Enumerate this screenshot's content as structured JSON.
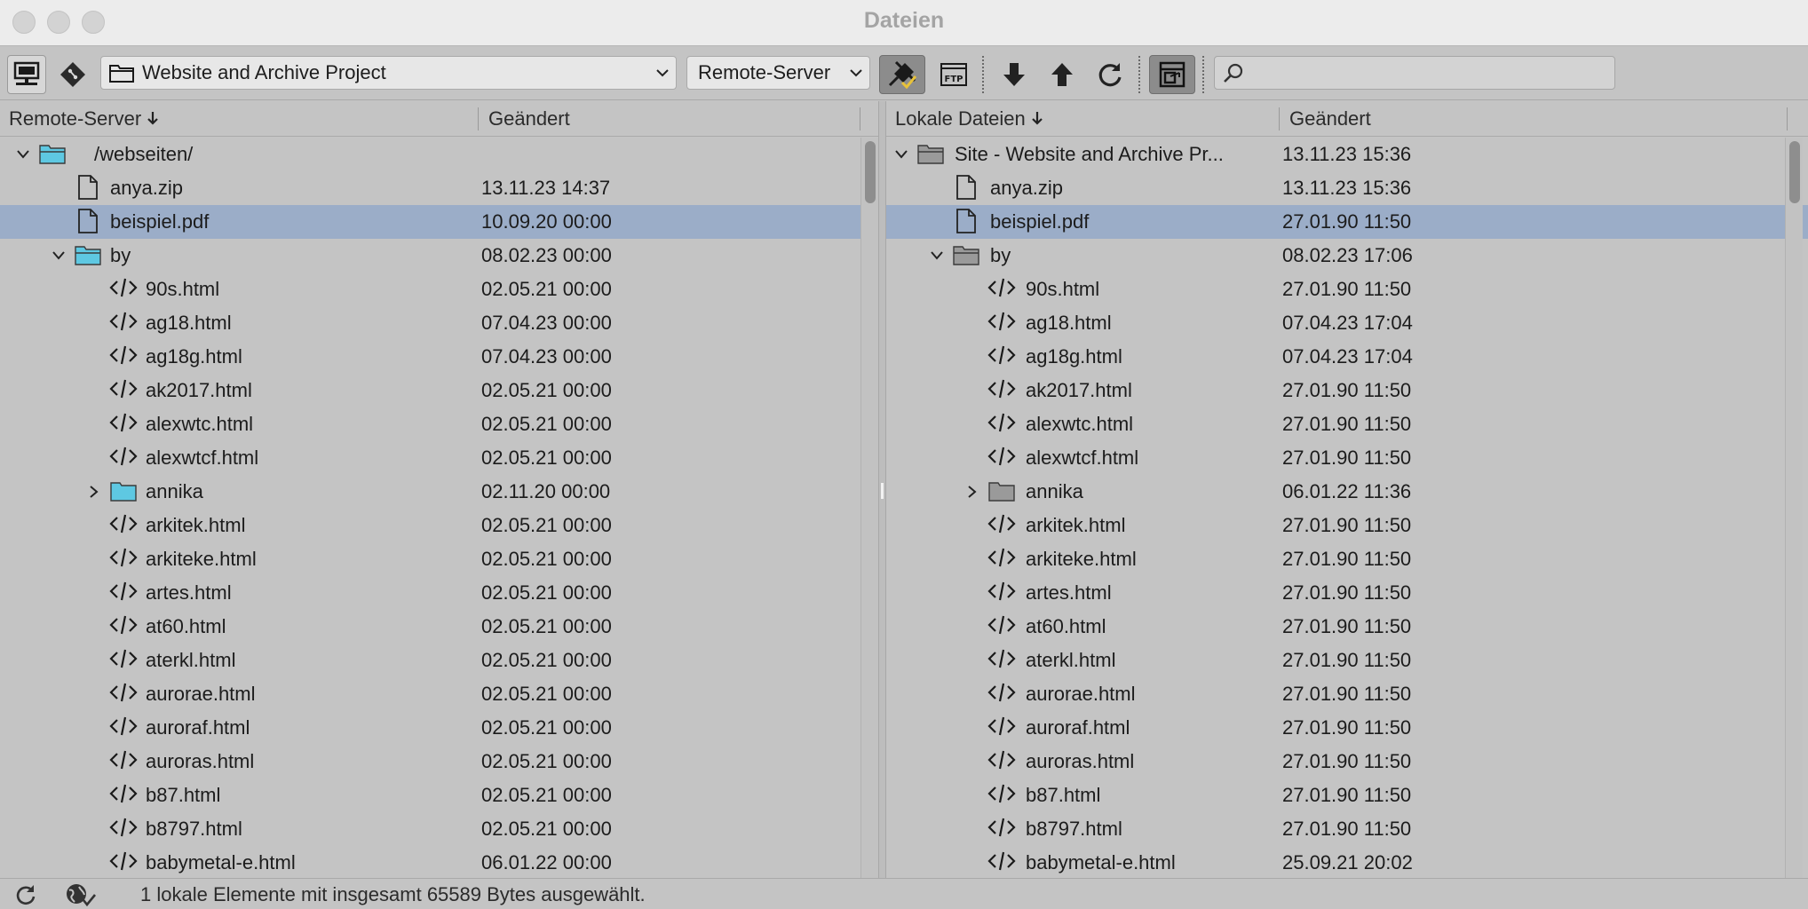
{
  "window": {
    "title": "Dateien"
  },
  "toolbar": {
    "site_select": "Website and Archive Project",
    "view_select": "Remote-Server",
    "search_placeholder": ""
  },
  "left_pane": {
    "col_name": "Remote-Server",
    "col_modified": "Geändert",
    "rows": [
      {
        "name": "/webseiten/",
        "date": "",
        "type": "folder-open",
        "selected": false
      },
      {
        "name": "anya.zip",
        "date": "13.11.23 14:37",
        "type": "file",
        "selected": false
      },
      {
        "name": "beispiel.pdf",
        "date": "10.09.20 00:00",
        "type": "file",
        "selected": true
      },
      {
        "name": "by",
        "date": "08.02.23 00:00",
        "type": "folder-open",
        "selected": false
      },
      {
        "name": "90s.html",
        "date": "02.05.21 00:00",
        "type": "code",
        "selected": false
      },
      {
        "name": "ag18.html",
        "date": "07.04.23 00:00",
        "type": "code",
        "selected": false
      },
      {
        "name": "ag18g.html",
        "date": "07.04.23 00:00",
        "type": "code",
        "selected": false
      },
      {
        "name": "ak2017.html",
        "date": "02.05.21 00:00",
        "type": "code",
        "selected": false
      },
      {
        "name": "alexwtc.html",
        "date": "02.05.21 00:00",
        "type": "code",
        "selected": false
      },
      {
        "name": "alexwtcf.html",
        "date": "02.05.21 00:00",
        "type": "code",
        "selected": false
      },
      {
        "name": "annika",
        "date": "02.11.20 00:00",
        "type": "folder-closed",
        "selected": false
      },
      {
        "name": "arkitek.html",
        "date": "02.05.21 00:00",
        "type": "code",
        "selected": false
      },
      {
        "name": "arkiteke.html",
        "date": "02.05.21 00:00",
        "type": "code",
        "selected": false
      },
      {
        "name": "artes.html",
        "date": "02.05.21 00:00",
        "type": "code",
        "selected": false
      },
      {
        "name": "at60.html",
        "date": "02.05.21 00:00",
        "type": "code",
        "selected": false
      },
      {
        "name": "aterkl.html",
        "date": "02.05.21 00:00",
        "type": "code",
        "selected": false
      },
      {
        "name": "aurorae.html",
        "date": "02.05.21 00:00",
        "type": "code",
        "selected": false
      },
      {
        "name": "auroraf.html",
        "date": "02.05.21 00:00",
        "type": "code",
        "selected": false
      },
      {
        "name": "auroras.html",
        "date": "02.05.21 00:00",
        "type": "code",
        "selected": false
      },
      {
        "name": "b87.html",
        "date": "02.05.21 00:00",
        "type": "code",
        "selected": false
      },
      {
        "name": "b8797.html",
        "date": "02.05.21 00:00",
        "type": "code",
        "selected": false
      },
      {
        "name": "babymetal-e.html",
        "date": "06.01.22 00:00",
        "type": "code",
        "selected": false
      }
    ]
  },
  "right_pane": {
    "col_name": "Lokale Dateien",
    "col_modified": "Geändert",
    "rows": [
      {
        "name": "Site - Website and Archive Pr...",
        "date": "13.11.23 15:36",
        "type": "folder-open",
        "selected": false
      },
      {
        "name": "anya.zip",
        "date": "13.11.23 15:36",
        "type": "file",
        "selected": false
      },
      {
        "name": "beispiel.pdf",
        "date": "27.01.90 11:50",
        "type": "file",
        "selected": true
      },
      {
        "name": "by",
        "date": "08.02.23 17:06",
        "type": "folder-open",
        "selected": false
      },
      {
        "name": "90s.html",
        "date": "27.01.90 11:50",
        "type": "code",
        "selected": false
      },
      {
        "name": "ag18.html",
        "date": "07.04.23 17:04",
        "type": "code",
        "selected": false
      },
      {
        "name": "ag18g.html",
        "date": "07.04.23 17:04",
        "type": "code",
        "selected": false
      },
      {
        "name": "ak2017.html",
        "date": "27.01.90 11:50",
        "type": "code",
        "selected": false
      },
      {
        "name": "alexwtc.html",
        "date": "27.01.90 11:50",
        "type": "code",
        "selected": false
      },
      {
        "name": "alexwtcf.html",
        "date": "27.01.90 11:50",
        "type": "code",
        "selected": false
      },
      {
        "name": "annika",
        "date": "06.01.22 11:36",
        "type": "folder-closed",
        "selected": false
      },
      {
        "name": "arkitek.html",
        "date": "27.01.90 11:50",
        "type": "code",
        "selected": false
      },
      {
        "name": "arkiteke.html",
        "date": "27.01.90 11:50",
        "type": "code",
        "selected": false
      },
      {
        "name": "artes.html",
        "date": "27.01.90 11:50",
        "type": "code",
        "selected": false
      },
      {
        "name": "at60.html",
        "date": "27.01.90 11:50",
        "type": "code",
        "selected": false
      },
      {
        "name": "aterkl.html",
        "date": "27.01.90 11:50",
        "type": "code",
        "selected": false
      },
      {
        "name": "aurorae.html",
        "date": "27.01.90 11:50",
        "type": "code",
        "selected": false
      },
      {
        "name": "auroraf.html",
        "date": "27.01.90 11:50",
        "type": "code",
        "selected": false
      },
      {
        "name": "auroras.html",
        "date": "27.01.90 11:50",
        "type": "code",
        "selected": false
      },
      {
        "name": "b87.html",
        "date": "27.01.90 11:50",
        "type": "code",
        "selected": false
      },
      {
        "name": "b8797.html",
        "date": "27.01.90 11:50",
        "type": "code",
        "selected": false
      },
      {
        "name": "babymetal-e.html",
        "date": "25.09.21 20:02",
        "type": "code",
        "selected": false
      }
    ]
  },
  "status": {
    "text": "1 lokale Elemente mit insgesamt 65589 Bytes ausgewählt."
  },
  "colors": {
    "selection": "#9badc8",
    "remote_folder": "#5ec8e2",
    "local_folder": "#9a9a9a"
  }
}
